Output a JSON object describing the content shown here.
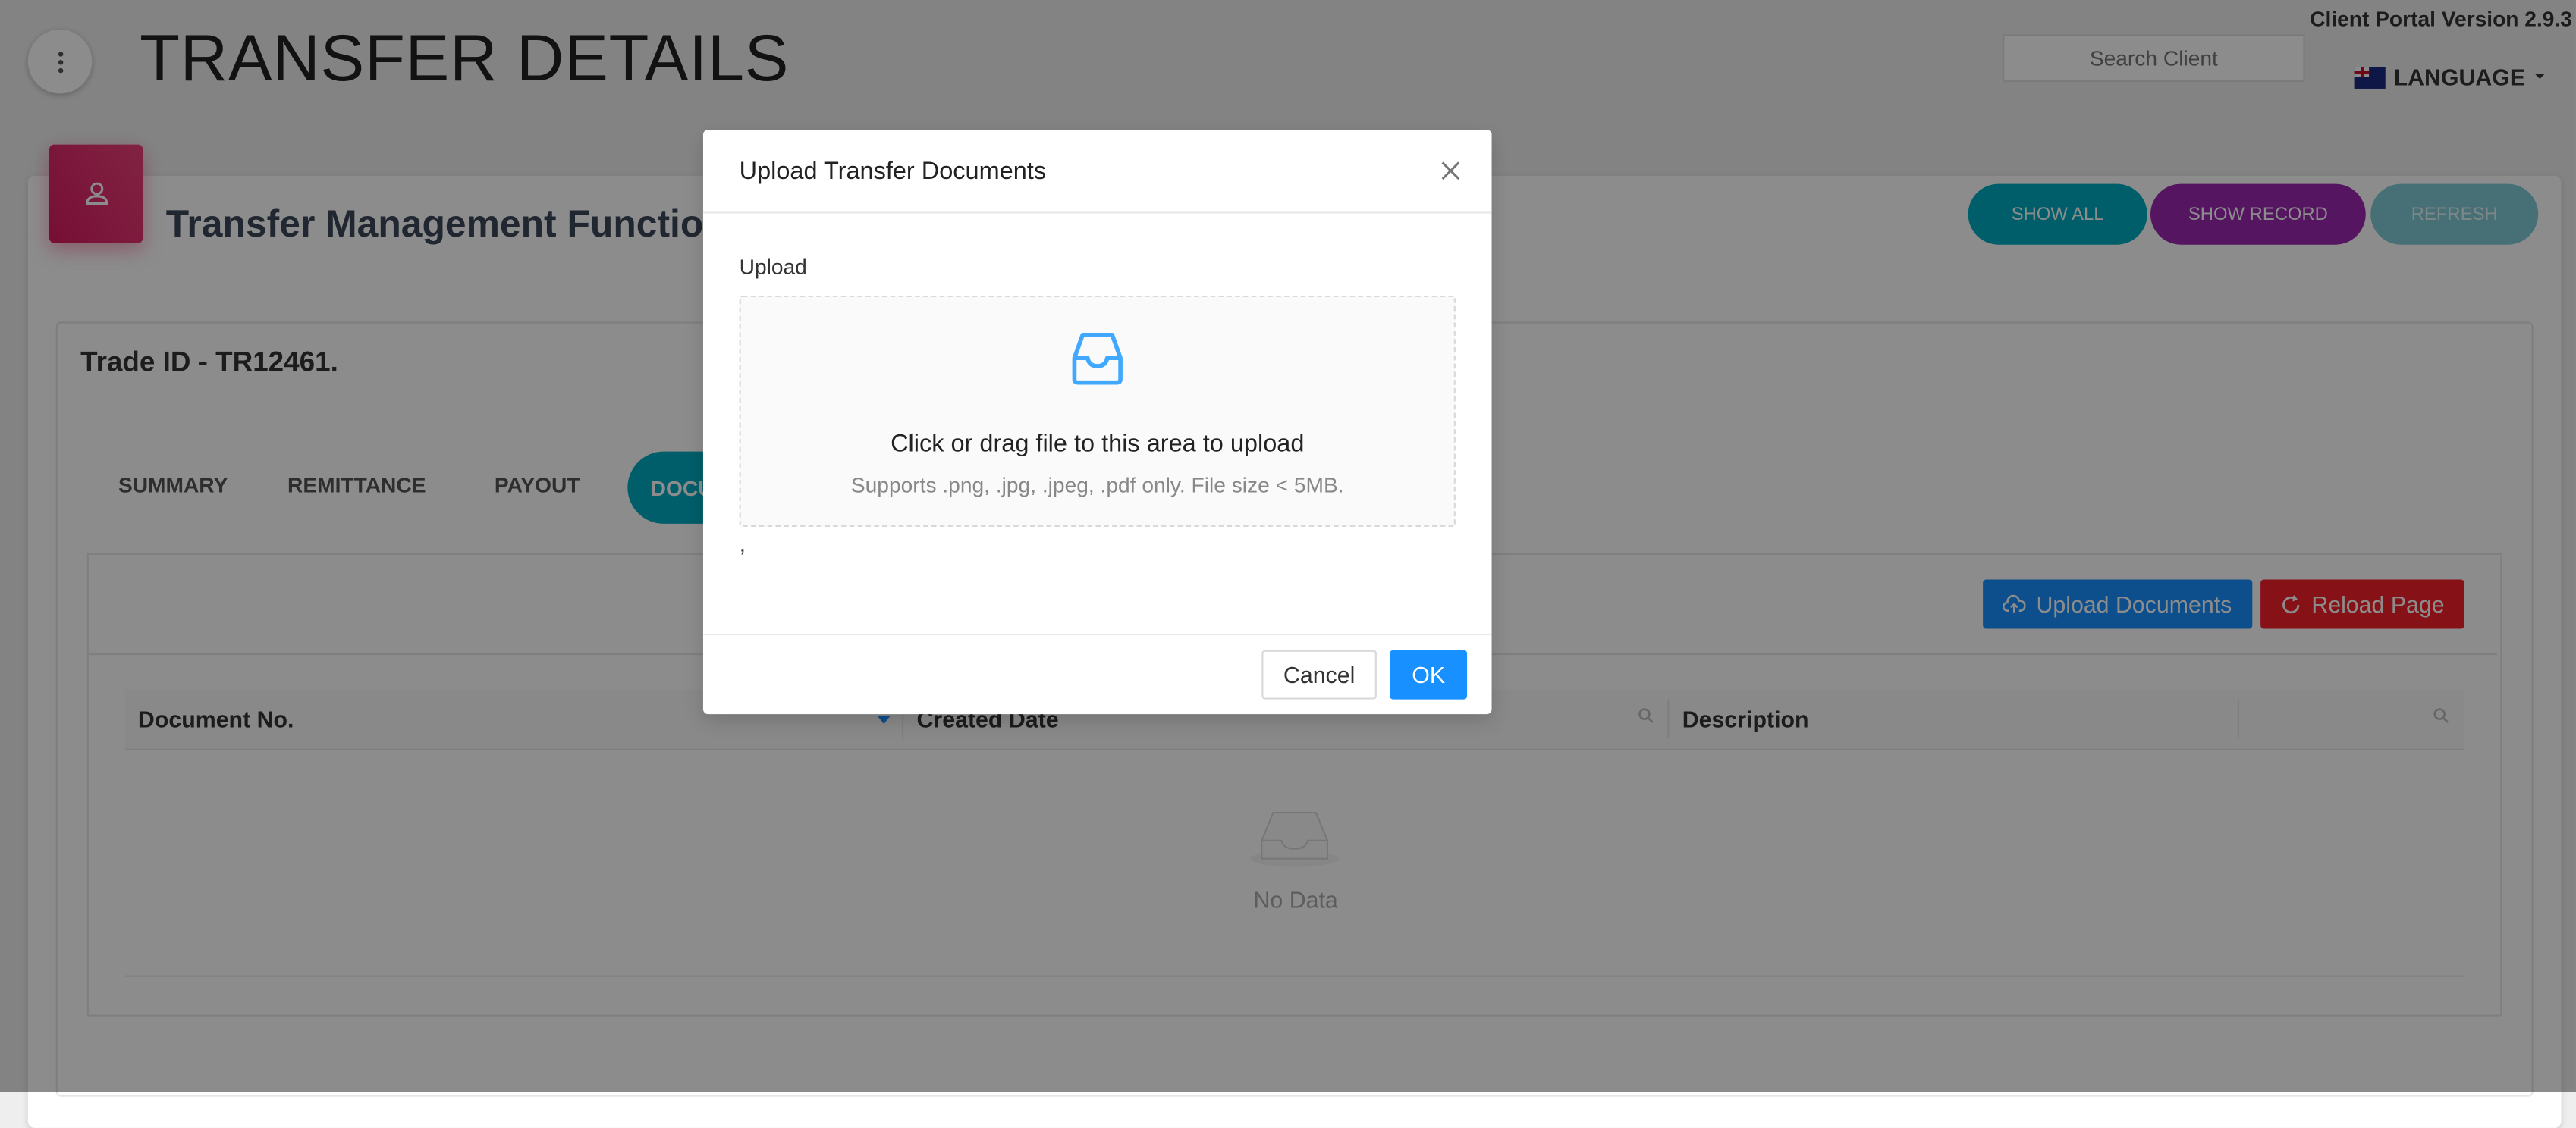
{
  "header": {
    "title": "TRANSFER DETAILS",
    "version": "Client Portal Version 2.9.3",
    "search_placeholder": "Search Client",
    "language": "LANGUAGE"
  },
  "card": {
    "title": "Transfer Management Functions",
    "buttons": {
      "show_all": "SHOW ALL",
      "show_record": "SHOW RECORD",
      "refresh": "REFRESH"
    }
  },
  "trade": {
    "id_text": "Trade ID - TR12461."
  },
  "tabs": [
    {
      "label": "SUMMARY"
    },
    {
      "label": "REMITTANCE"
    },
    {
      "label": "PAYOUT"
    },
    {
      "label": "DOCU",
      "active": true
    }
  ],
  "documents": {
    "upload_label": "Upload Documents",
    "reload_label": "Reload Page",
    "columns": [
      "Document No.",
      "Created Date",
      "Description"
    ],
    "empty_text": "No Data"
  },
  "modal": {
    "title": "Upload Transfer Documents",
    "field_label": "Upload",
    "drop_text": "Click or drag file to this area to upload",
    "drop_hint": "Supports .png, .jpg, .jpeg, .pdf only. File size < 5MB.",
    "file_list_text": ",",
    "cancel_label": "Cancel",
    "ok_label": "OK"
  },
  "colors": {
    "primary": "#1890ff",
    "danger": "#f5222d",
    "teal": "#00acc1",
    "purple": "#9c27b0",
    "pink": "#e91e63"
  }
}
